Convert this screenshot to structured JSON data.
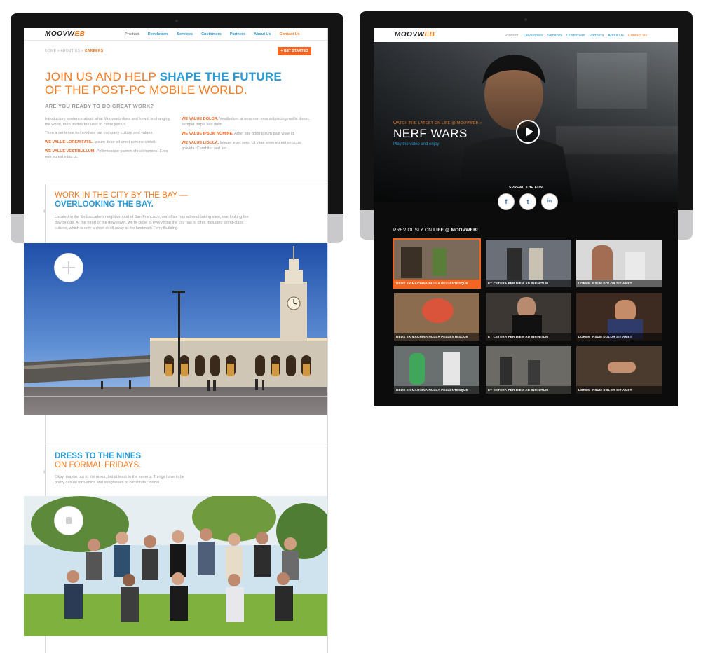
{
  "left_page": {
    "logo": {
      "prefix": "MOOVW",
      "accent": "EB"
    },
    "nav": [
      "Product",
      "Developers",
      "Services",
      "Customers",
      "Partners",
      "About Us",
      "Contact Us"
    ],
    "breadcrumb": {
      "home": "HOME",
      "sep1": "»",
      "about": "ABOUT US",
      "sep2": "»",
      "current": "CAREERS"
    },
    "cta": "+ GET STARTED",
    "hero": {
      "line1_a": "JOIN US AND HELP ",
      "line1_b": "SHAPE THE FUTURE",
      "line2": "OF THE POST-PC MOBILE WORLD.",
      "subhead": "ARE YOU READY TO DO GREAT WORK?"
    },
    "intro_1": "Introductory sentence about what Moovweb does and how it is changing the world, then invites the user to come join us.",
    "intro_2": "Then a sentence to introduce our company culture and values.",
    "values_left": [
      {
        "label": "WE VALUE LOREM FATIL.",
        "text": "Ipsum dolor sit amet nomine christi."
      },
      {
        "label": "WE VALUE VESTIBULLUM.",
        "text": "Pellentesque pamen christi nomine. Eros non eu est vitau ut."
      }
    ],
    "values_right": [
      {
        "label": "WE VALUE DOLOR.",
        "text": "Vestibulum at eros non eros adipiscing mollis donec semper turpis sed diem."
      },
      {
        "label": "WE VALUE IPSUM NOMINE.",
        "text": "Amet site dolor ipsum palit vitae id."
      },
      {
        "label": "WE VALUE LIGULA.",
        "text": "Integer eget sem. Ut vitae enim eu est vehicula gravida. Curabitur sed leo."
      }
    ],
    "section_bay": {
      "title_1": "WORK IN THE CITY BY THE BAY —",
      "title_2": "OVERLOOKING THE BAY.",
      "text": "Located in the Embarcadero neighborhood of San Francisco, our office has a breathtaking view, overlooking the Bay Bridge. At the heart of the downtown, we're close to everything the city has to offer, including world-class cuisine, which is only a short stroll away at the landmark Ferry Building."
    },
    "section_nines": {
      "title_1": "DRESS TO THE NINES",
      "title_2": "ON FORMAL FRIDAYS.",
      "text": "Okay, maybe not to the nines, but at least to the sevens. Things have to be pretty casual for t-shirts and sunglasses to constitute \"formal.\""
    }
  },
  "right_page": {
    "logo": {
      "prefix": "MOOVW",
      "accent": "EB"
    },
    "nav": [
      "Product",
      "Developers",
      "Services",
      "Customers",
      "Partners",
      "About Us",
      "Contact Us"
    ],
    "hero": {
      "kicker": "WATCH THE LATEST ON LIFE @ MOOVWEB »",
      "title": "NERF WARS",
      "link": "Play the video and enjoy"
    },
    "share_label": "SPREAD THE FUN",
    "social": [
      "f",
      "t",
      "in"
    ],
    "previously_a": "PREVIOUSLY ON ",
    "previously_b": "LIFE @ MOOVWEB:",
    "videos": [
      {
        "caption": "DEUS EX MACHINA NULLA PELLENTESQUE"
      },
      {
        "caption": "ET CETERA PER DIEM AD INFINITUM"
      },
      {
        "caption": "LOREM IPSUM DOLOR SIT AMET"
      },
      {
        "caption": "DEUS EX MACHINA NULLA PELLENTESQUE"
      },
      {
        "caption": "ET CETERA PER DIEM AD INFINITUM"
      },
      {
        "caption": "LOREM IPSUM DOLOR SIT AMET"
      },
      {
        "caption": "DEUS EX MACHINA NULLA PELLENTESQUE"
      },
      {
        "caption": "ET CETERA PER DIEM AD INFINITUM"
      },
      {
        "caption": "LOREM IPSUM DOLOR SIT AMET"
      }
    ],
    "selected_video": 0
  },
  "colors": {
    "orange": "#f47b20",
    "blue": "#2a9bd6",
    "frame": "#141414"
  }
}
